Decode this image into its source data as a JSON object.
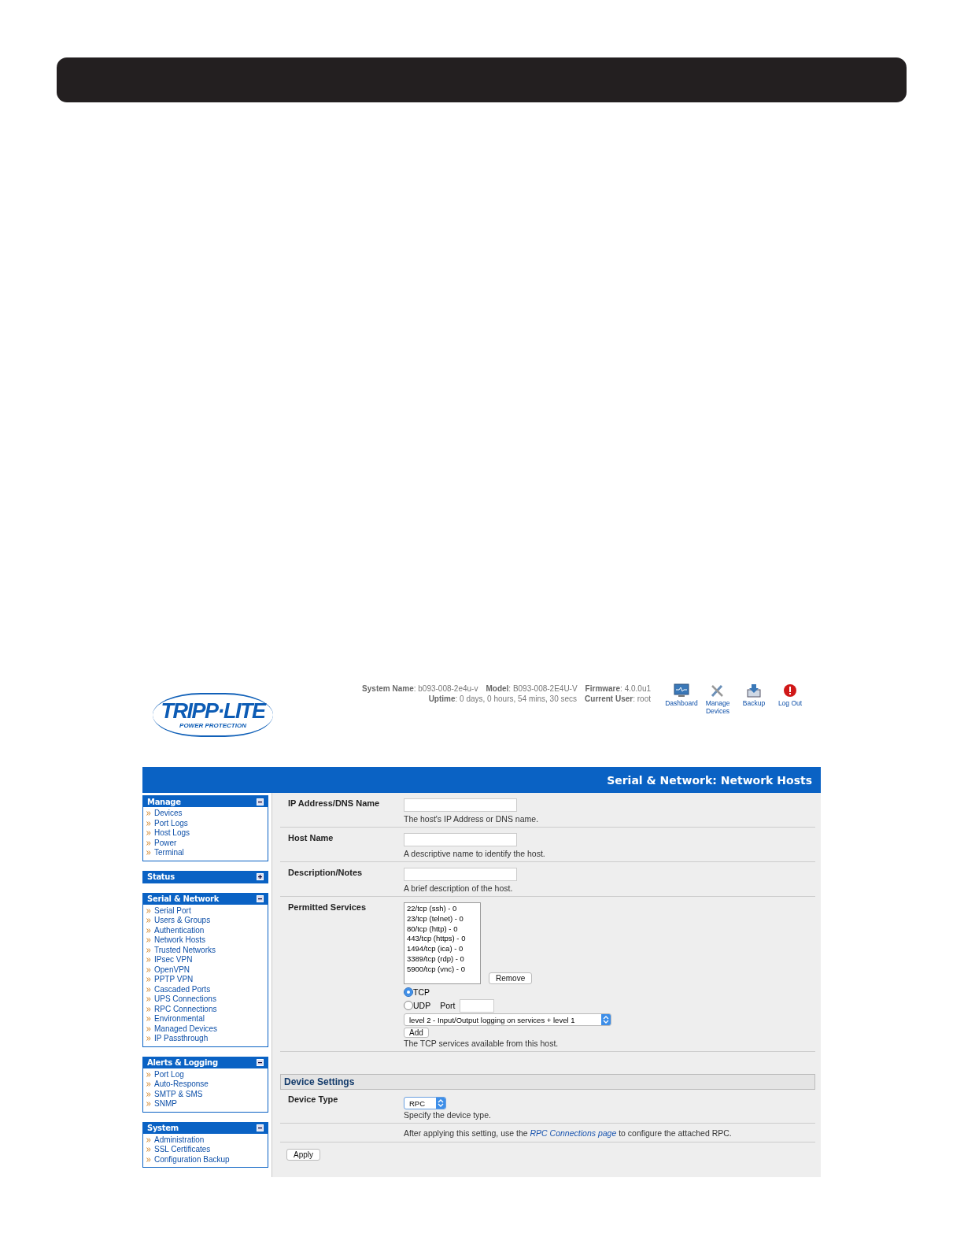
{
  "logo": {
    "name": "TRIPP·LITE",
    "tagline": "POWER PROTECTION"
  },
  "system_info": [
    [
      {
        "label": "System Name",
        "value": ": b093-008-2e4u-v"
      },
      {
        "label": "Model",
        "value": ": B093-008-2E4U-V"
      },
      {
        "label": "Firmware",
        "value": ": 4.0.0u1"
      }
    ],
    [
      {
        "label": "Uptime",
        "value": ": 0 days, 0 hours, 54 mins, 30 secs"
      },
      {
        "label": "Current User",
        "value": ": root"
      }
    ]
  ],
  "toolbar": [
    {
      "kind": "dashboard",
      "label": "Dashboard"
    },
    {
      "kind": "tools",
      "label": "Manage Devices"
    },
    {
      "kind": "backup",
      "label": "Backup"
    },
    {
      "kind": "logout",
      "label": "Log Out"
    }
  ],
  "page_title": "Serial & Network: Network Hosts",
  "sidebar": [
    {
      "title": "Manage",
      "expanded": true,
      "items": [
        "Devices",
        "Port Logs",
        "Host Logs",
        "Power",
        "Terminal"
      ]
    },
    {
      "title": "Status",
      "expanded": false
    },
    {
      "title": "Serial & Network",
      "expanded": true,
      "items": [
        "Serial Port",
        "Users & Groups",
        "Authentication",
        "Network Hosts",
        "Trusted Networks",
        "IPsec VPN",
        "OpenVPN",
        "PPTP VPN",
        "Cascaded Ports",
        "UPS Connections",
        "RPC Connections",
        "Environmental",
        "Managed Devices",
        "IP Passthrough"
      ]
    },
    {
      "title": "Alerts & Logging",
      "expanded": true,
      "items": [
        "Port Log",
        "Auto-Response",
        "SMTP & SMS",
        "SNMP"
      ]
    },
    {
      "title": "System",
      "expanded": true,
      "items": [
        "Administration",
        "SSL Certificates",
        "Configuration Backup"
      ]
    }
  ],
  "fields": [
    {
      "label": "IP Address/DNS Name",
      "hint": "The host's IP Address or DNS name."
    },
    {
      "label": "Host Name",
      "hint": "A descriptive name to identify the host."
    },
    {
      "label": "Description/Notes",
      "hint": "A brief description of the host."
    }
  ],
  "permitted_services": {
    "label": "Permitted Services",
    "services": [
      "22/tcp (ssh) - 0",
      "23/tcp (telnet) - 0",
      "80/tcp (http) - 0",
      "443/tcp (https) - 0",
      "1494/tcp (ica) - 0",
      "3389/tcp (rdp) - 0",
      "5900/tcp (vnc) - 0"
    ],
    "remove_button": "Remove",
    "protocols": [
      {
        "label": "TCP",
        "selected": true
      },
      {
        "label": "UDP",
        "selected": false
      }
    ],
    "port_label": "Port",
    "logging_level": "level 2 - Input/Output logging on services + level 1",
    "add_button": "Add",
    "hint": "The TCP services available from this host."
  },
  "device_settings": {
    "title": "Device Settings",
    "label": "Device Type",
    "value": "RPC",
    "hint": "Specify the device type.",
    "note_before": "After applying this setting, use the ",
    "note_link": "RPC Connections page",
    "note_after": " to configure the attached RPC."
  },
  "apply_button": "Apply"
}
